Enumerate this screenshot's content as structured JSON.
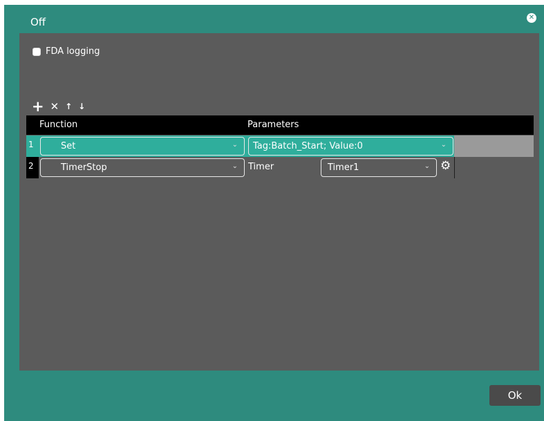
{
  "window": {
    "title": "Off",
    "close_icon": "close-circle-icon"
  },
  "fda": {
    "label": "FDA logging",
    "checked": false
  },
  "toolbar": {
    "add_icon": "plus-icon",
    "delete_icon": "x-icon",
    "up_icon": "arrow-up-icon",
    "down_icon": "arrow-down-icon"
  },
  "grid": {
    "headers": {
      "function": "Function",
      "parameters": "Parameters"
    },
    "rows": [
      {
        "num": "1",
        "function": "Set",
        "parameters": "Tag:Batch_Start; Value:0",
        "selected": true
      },
      {
        "num": "2",
        "function": "TimerStop",
        "param_label": "Timer",
        "param_value": "Timer1",
        "selected": false
      }
    ]
  },
  "footer": {
    "ok_label": "Ok"
  },
  "colors": {
    "dialog_bg": "#2e8b7e",
    "panel_bg": "#5b5b5b",
    "selected_row": "#2fae9c",
    "header_bg": "#000000"
  }
}
